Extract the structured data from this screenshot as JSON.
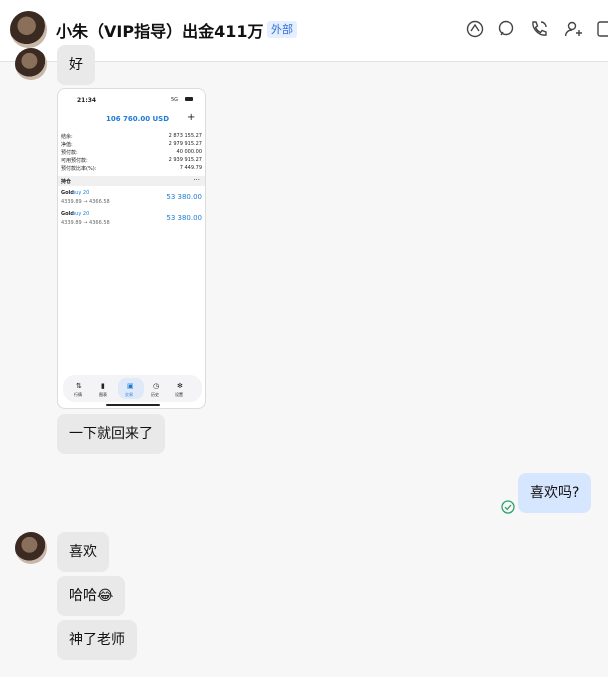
{
  "header": {
    "title": "小朱（VIP指导）出金411万",
    "badge": "外部",
    "icons": [
      "moments-icon",
      "chat-search-icon",
      "phone-icon",
      "add-contact-icon",
      "window-icon"
    ]
  },
  "messages": {
    "top_partial": "好",
    "image": {
      "time": "21:34",
      "signal": "5G",
      "balance_title": "106 760.00 USD",
      "rows": [
        {
          "label": "结余:",
          "value": "2 873 155.27"
        },
        {
          "label": "净值:",
          "value": "2 979 915.27"
        },
        {
          "label": "预付款:",
          "value": "40 000.00"
        },
        {
          "label": "可用预付款:",
          "value": "2 939 915.27"
        },
        {
          "label": "预付款比率(%):",
          "value": "7 449.79"
        }
      ],
      "section": "持仓",
      "positions": [
        {
          "name": "Gold",
          "side": "buy 20",
          "prices": "4339.89 → 4366.58",
          "profit": "53 380.00"
        },
        {
          "name": "Gold",
          "side": "buy 20",
          "prices": "4339.89 → 4366.58",
          "profit": "53 380.00"
        }
      ],
      "tabs": [
        "行情",
        "图表",
        "交易",
        "历史",
        "设置"
      ]
    },
    "m1": "一下就回来了",
    "m2": "喜欢吗?",
    "m3": "喜欢",
    "m4": "哈哈😂",
    "m5": "神了老师"
  },
  "colors": {
    "accent": "#1e7bd6",
    "bubble_other": "#e9e9ea",
    "bubble_me": "#d7e6ff",
    "read": "#2aa26b"
  }
}
